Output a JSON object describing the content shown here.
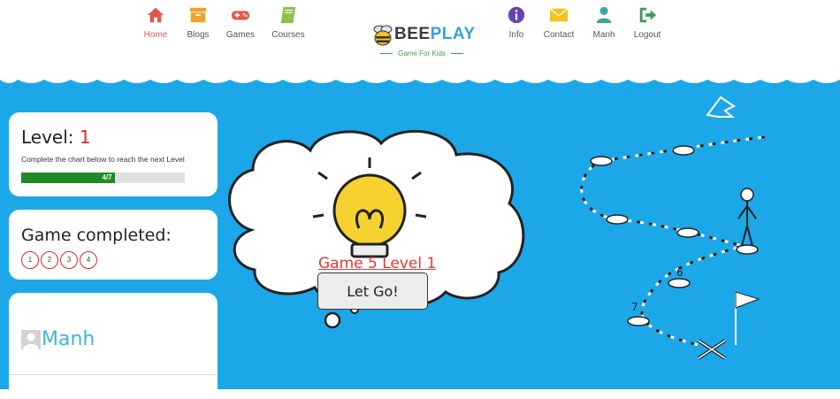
{
  "nav": {
    "items": [
      {
        "label": "Home",
        "icon": "home-icon",
        "active": true
      },
      {
        "label": "Blogs",
        "icon": "archive-icon"
      },
      {
        "label": "Games",
        "icon": "gamepad-icon"
      },
      {
        "label": "Courses",
        "icon": "book-icon"
      },
      {
        "label": "Info",
        "icon": "info-icon"
      },
      {
        "label": "Contact",
        "icon": "envelope-icon"
      },
      {
        "label": "Manh",
        "icon": "user-icon"
      },
      {
        "label": "Logout",
        "icon": "logout-icon"
      }
    ]
  },
  "logo": {
    "part1": "BEE",
    "part2": "PLAY",
    "tagline": "Game For Kids"
  },
  "level_card": {
    "title": "Level: ",
    "level": "1",
    "description": "Complete the chart below to reach the next Level",
    "progress_label": "4/7",
    "progress_fraction": 0.571
  },
  "games_card": {
    "title": "Game completed:",
    "games": [
      "1",
      "2",
      "3",
      "4"
    ]
  },
  "user_card": {
    "name": "Manh"
  },
  "center": {
    "game_link": "Game 5 Level 1",
    "go_button": "Let Go!"
  },
  "map": {
    "step_labels": [
      "6",
      "7"
    ]
  },
  "colors": {
    "sky": "#1ca7e8",
    "progress": "#1f8a26",
    "accent_red": "#d42b2b",
    "username": "#39b9d9"
  }
}
